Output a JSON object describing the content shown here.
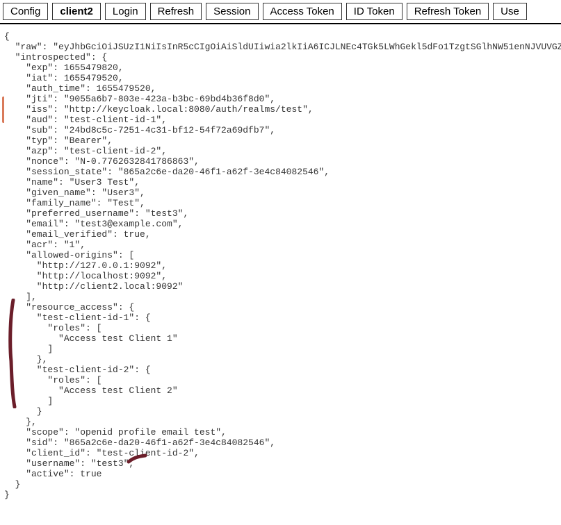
{
  "tabs": [
    {
      "label": "Config",
      "active": false
    },
    {
      "label": "client2",
      "active": true
    },
    {
      "label": "Login",
      "active": false
    },
    {
      "label": "Refresh",
      "active": false
    },
    {
      "label": "Session",
      "active": false
    },
    {
      "label": "Access Token",
      "active": false
    },
    {
      "label": "ID Token",
      "active": false
    },
    {
      "label": "Refresh Token",
      "active": false
    },
    {
      "label": "Use",
      "active": false
    }
  ],
  "json_text": "{\n  \"raw\": \"eyJhbGciOiJSUzI1NiIsInR5cCIgOiAiSldUIiwia2lkIiA6ICJLNEc4TGk5LWhGekl5dFo1TzgtSGlhNW51enNJVUVGZy1tSWFHZ\n  \"introspected\": {\n    \"exp\": 1655479820,\n    \"iat\": 1655479520,\n    \"auth_time\": 1655479520,\n    \"jti\": \"9055a6b7-803e-423a-b3bc-69bd4b36f8d0\",\n    \"iss\": \"http://keycloak.local:8080/auth/realms/test\",\n    \"aud\": \"test-client-id-1\",\n    \"sub\": \"24bd8c5c-7251-4c31-bf12-54f72a69dfb7\",\n    \"typ\": \"Bearer\",\n    \"azp\": \"test-client-id-2\",\n    \"nonce\": \"N-0.7762632841786863\",\n    \"session_state\": \"865a2c6e-da20-46f1-a62f-3e4c84082546\",\n    \"name\": \"User3 Test\",\n    \"given_name\": \"User3\",\n    \"family_name\": \"Test\",\n    \"preferred_username\": \"test3\",\n    \"email\": \"test3@example.com\",\n    \"email_verified\": true,\n    \"acr\": \"1\",\n    \"allowed-origins\": [\n      \"http://127.0.0.1:9092\",\n      \"http://localhost:9092\",\n      \"http://client2.local:9092\"\n    ],\n    \"resource_access\": {\n      \"test-client-id-1\": {\n        \"roles\": [\n          \"Access test Client 1\"\n        ]\n      },\n      \"test-client-id-2\": {\n        \"roles\": [\n          \"Access test Client 2\"\n        ]\n      }\n    },\n    \"scope\": \"openid profile email test\",\n    \"sid\": \"865a2c6e-da20-46f1-a62f-3e4c84082546\",\n    \"client_id\": \"test-client-id-2\",\n    \"username\": \"test3\",\n    \"active\": true\n  }\n}"
}
